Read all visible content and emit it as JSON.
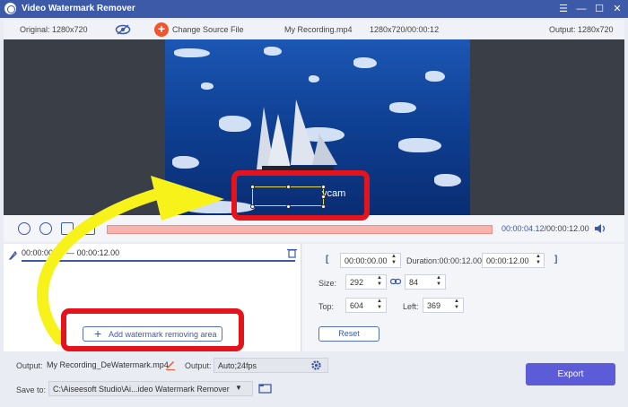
{
  "window": {
    "title": "Video Watermark Remover"
  },
  "info": {
    "original": "Original: 1280x720",
    "change_source": "Change Source File",
    "filename": "My Recording.mp4",
    "meta": "1280x720/00:00:12",
    "output": "Output: 1280x720"
  },
  "video": {
    "watermark_text": "ycam"
  },
  "timeline": {
    "current": "00:00:04.12",
    "total": "/00:00:12.00"
  },
  "segment": {
    "start": "00:00:00.00",
    "end": "00:00:12.00"
  },
  "add_area_label": "Add watermark removing area",
  "settings": {
    "start": "00:00:00.00",
    "duration_label": "Duration:00:00:12.00",
    "end": "00:00:12.00",
    "size_label": "Size:",
    "width": "292",
    "height": "84",
    "top_label": "Top:",
    "top": "604",
    "left_label": "Left:",
    "left": "369",
    "reset": "Reset"
  },
  "bottom": {
    "output_label": "Output:",
    "output_file": "My Recording_DeWatermark.mp4",
    "output_label2": "Output:",
    "output_format": "Auto;24fps",
    "save_label": "Save to:",
    "save_path": "C:\\Aiseesoft Studio\\Ai...ideo Watermark Remover",
    "export": "Export"
  },
  "colors": {
    "accent": "#3d5aa8",
    "highlight": "#e5131b",
    "arrow": "#f7f21a",
    "export": "#5d5cd8"
  }
}
